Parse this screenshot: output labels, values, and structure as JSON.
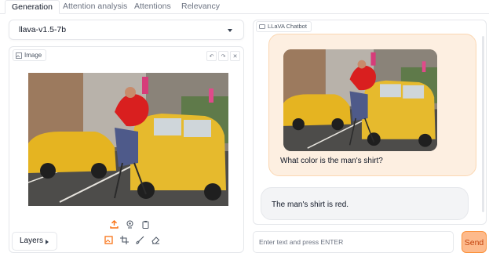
{
  "tabs": [
    {
      "label": "Generation",
      "active": true
    },
    {
      "label": "Attention analysis",
      "active": false
    },
    {
      "label": "Attentions",
      "active": false
    },
    {
      "label": "Relevancy",
      "active": false
    }
  ],
  "model_select": {
    "value": "llava-v1.5-7b",
    "icon": "chevron-down-icon"
  },
  "image_panel": {
    "label": "Image",
    "label_icon": "image-icon",
    "actions": [
      "undo-icon",
      "redo-icon",
      "close-icon"
    ],
    "source_tools": [
      "upload-icon",
      "webcam-icon",
      "clipboard-icon"
    ],
    "edit_tools": [
      "image-icon",
      "crop-icon",
      "brush-icon",
      "eraser-icon"
    ],
    "layers_label": "Layers"
  },
  "chatbot": {
    "label": "LLaVA Chatbot",
    "label_icon": "chat-icon",
    "messages": [
      {
        "role": "user",
        "text": "What color is the man's shirt?",
        "has_image": true
      },
      {
        "role": "assistant",
        "text": "The man's shirt is red."
      }
    ]
  },
  "input": {
    "placeholder": "Enter text and press ENTER",
    "value": ""
  },
  "send_label": "Send",
  "colors": {
    "accent": "#f97316",
    "user_bubble": "#fdefe1",
    "send_bg": "#fdba8c"
  }
}
